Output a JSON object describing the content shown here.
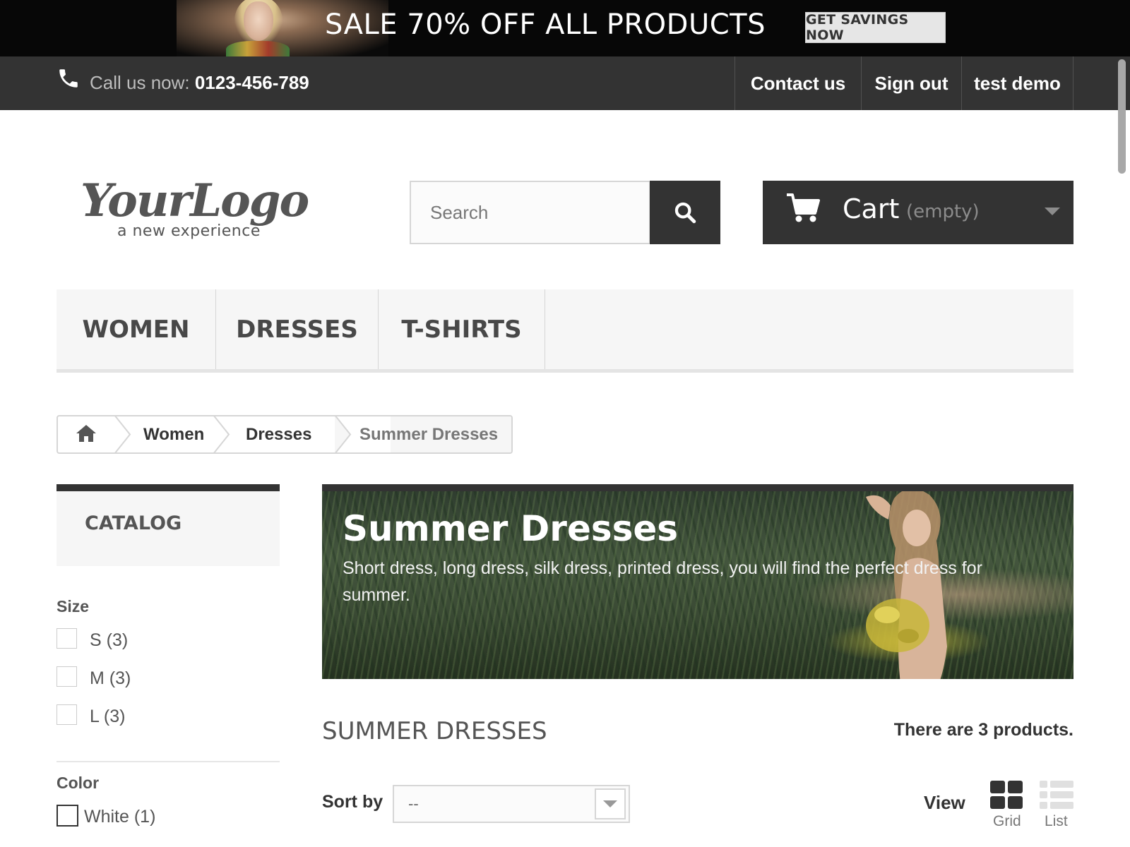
{
  "promo": {
    "text": "SALE 70% OFF ALL PRODUCTS",
    "button_label": "GET SAVINGS NOW"
  },
  "topbar": {
    "call_prefix": "Call us now: ",
    "phone_number": "0123-456-789",
    "links": [
      "Contact us",
      "Sign out",
      "test demo"
    ]
  },
  "header": {
    "logo_text": "YourLogo",
    "logo_tagline": "a new experience",
    "search_placeholder": "Search",
    "cart_label": "Cart",
    "cart_status": "(empty)"
  },
  "menu": {
    "items": [
      "WOMEN",
      "DRESSES",
      "T-SHIRTS"
    ]
  },
  "breadcrumb": {
    "items": [
      "Women",
      "Dresses",
      "Summer Dresses"
    ]
  },
  "sidebar": {
    "catalog_title": "CATALOG",
    "size_title": "Size",
    "sizes": [
      "S (3)",
      "M (3)",
      "L (3)"
    ],
    "color_title": "Color",
    "colors": [
      "White (1)"
    ]
  },
  "category": {
    "banner_title": "Summer Dresses",
    "banner_description": "Short dress, long dress, silk dress, printed dress, you will find the perfect dress for summer.",
    "heading": "SUMMER DRESSES",
    "product_count": "There are 3 products."
  },
  "toolbar": {
    "sort_label": "Sort by",
    "sort_value": "--",
    "view_label": "View",
    "grid_label": "Grid",
    "list_label": "List"
  },
  "colors": {
    "dark": "#333333",
    "promo_bg": "#070707",
    "menu_bg": "#f6f6f6"
  }
}
